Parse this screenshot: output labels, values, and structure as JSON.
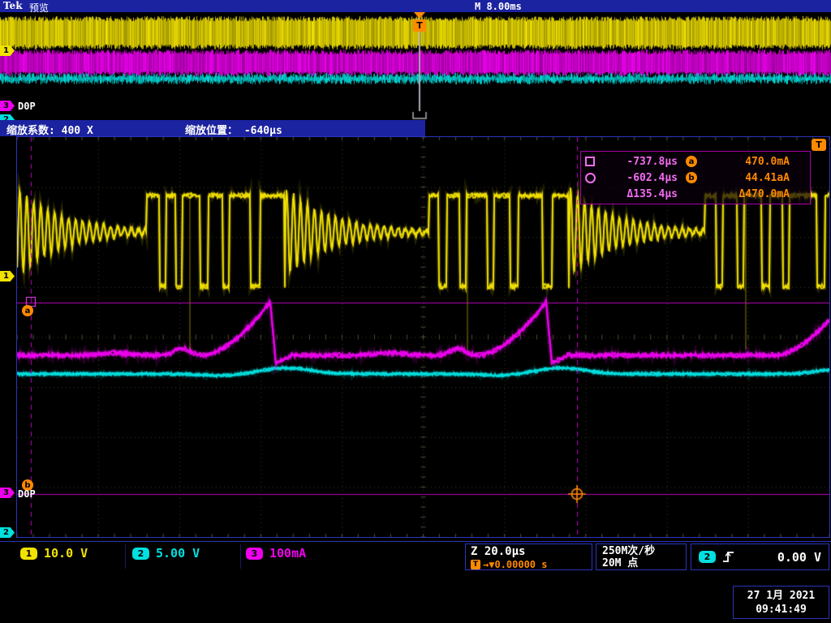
{
  "colors": {
    "ch1": "#f2e202",
    "ch2": "#00e0e0",
    "ch3": "#ee00ee",
    "orange": "#ff8a00",
    "grid": "#3d3d24",
    "bar_blue": "#1c23a0",
    "cursor": "#cf00cf",
    "border_blue": "#2d34bd"
  },
  "top_bar": {
    "brand": "Tek",
    "mode": "预览",
    "timebase": "M 8.00ms"
  },
  "overview": {
    "trigger_flag": "T",
    "ch1_marker": "1",
    "ch3_marker": "3",
    "ch3_label": "D0P",
    "ch2_marker": "2"
  },
  "zoom_bar": {
    "factor": "缩放系数: 400 X",
    "position": "缩放位置： -640µs"
  },
  "main": {
    "trigger_badge": "T",
    "ch1_marker": "1",
    "ch3_marker": "3",
    "ch3_label": "D0P",
    "ch2_marker": "2",
    "cursor_a": "a",
    "cursor_b": "b"
  },
  "readout": {
    "rows": [
      {
        "time": "-737.8µs",
        "badge": "a",
        "amp": "470.0mA"
      },
      {
        "time": "-602.4µs",
        "badge": "b",
        "amp": "44.41aA"
      },
      {
        "time": "Δ135.4µs",
        "badge": "",
        "amp": "Δ470.0mA"
      }
    ]
  },
  "status": {
    "ch1": {
      "num": "1",
      "scale": "10.0 V"
    },
    "ch2": {
      "num": "2",
      "scale": "5.00 V"
    },
    "ch3": {
      "num": "3",
      "scale": "100mA"
    },
    "zoom_scale": "Z 20.0µs",
    "trig_badge": "T",
    "trig_pos": "→▼0.00000 s",
    "sample_rate": "250M次/秒",
    "record_length": "20M 点",
    "trigger": {
      "num": "2",
      "level": "0.00 V"
    }
  },
  "datetime": {
    "date": "27 1月 2021",
    "time": "09:41:49"
  }
}
